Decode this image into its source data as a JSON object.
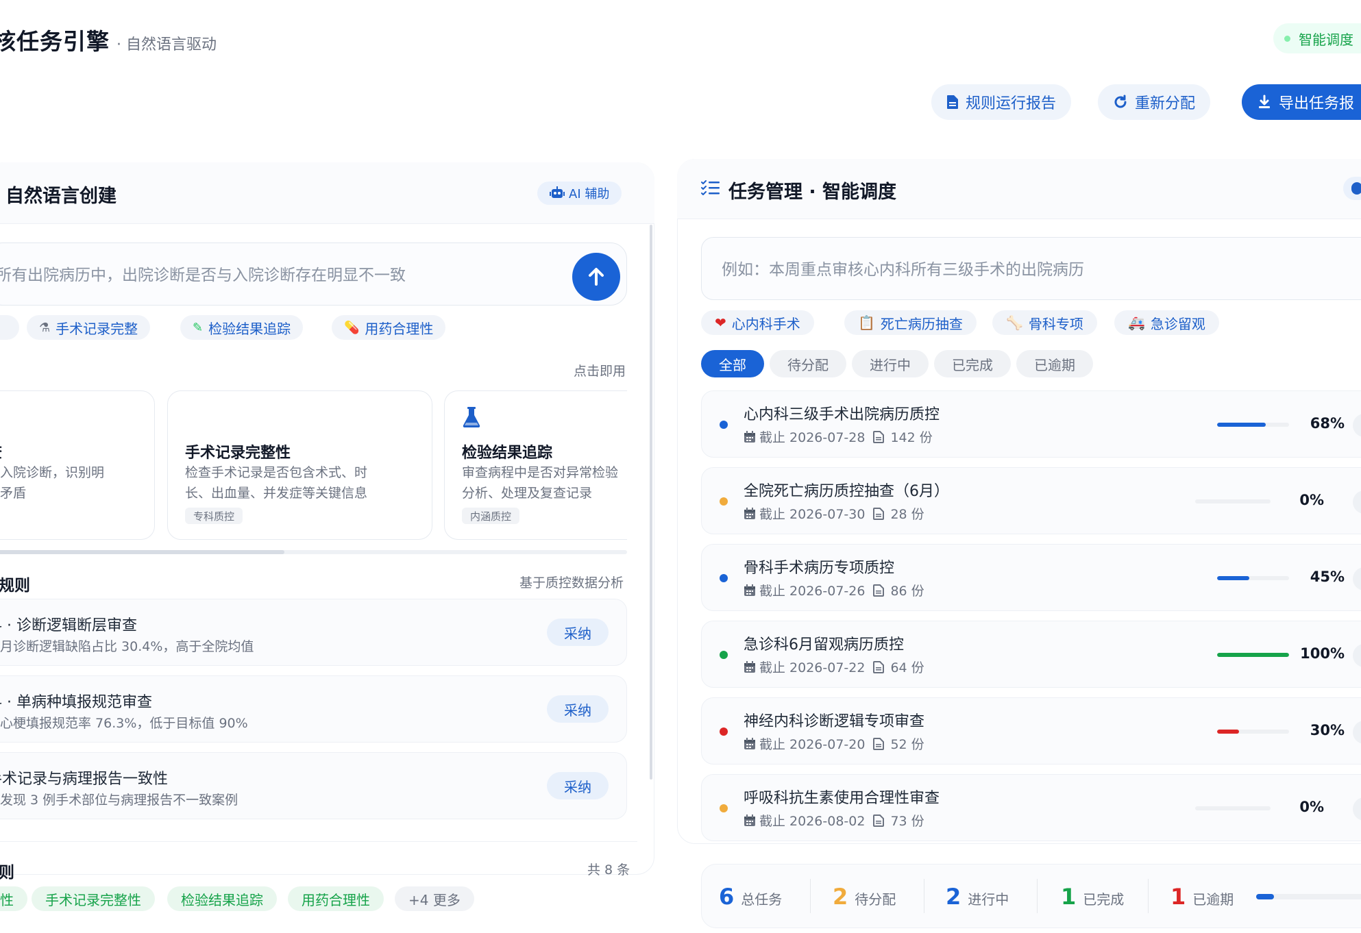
{
  "header": {
    "title": "核任务引擎",
    "subtitle": "· 自然语言驱动",
    "status_badge": "智能调度",
    "buttons": {
      "report": "规则运行报告",
      "reassign": "重新分配",
      "export": "导出任务报"
    }
  },
  "left": {
    "panel_title": "自然语言创建",
    "ai_badge": "AI 辅助",
    "input_value": "所有出院病历中，出院诊断是否与入院诊断存在明显不一致",
    "quick_chips": [
      "手术记录完整",
      "检验结果追踪",
      "用药合理性"
    ],
    "template_hint": "点击即用",
    "templates": [
      {
        "title": "查",
        "desc1": "与入院诊断，识别明",
        "desc2": "盾矛盾"
      },
      {
        "title": "手术记录完整性",
        "desc1": "检查手术记录是否包含术式、时",
        "desc2": "长、出血量、并发症等关键信息",
        "tag": "专科质控"
      },
      {
        "title": "检验结果追踪",
        "desc1": "审查病程中是否对异常检验",
        "desc2": "分析、处理及复查记录",
        "tag": "内涵质控"
      }
    ],
    "rules_title": "规则",
    "rules_hint": "基于质控数据分析",
    "adopt_label": "采纳",
    "rules": [
      {
        "title": "科 · 诊断逻辑断层审查",
        "desc": "三月诊断逻辑缺陷占比 30.4%，高于全院均值"
      },
      {
        "title": "科 · 单病种填报规范审查",
        "desc": "性心梗填报规范率 76.3%，低于目标值 90%"
      },
      {
        "title": "手术记录与病理报告一致性",
        "desc": "期发现 3 例手术部位与病理报告不一致案例"
      }
    ],
    "tags_title": "则",
    "tags_count": "共 8 条",
    "tags": [
      "性",
      "手术记录完整性",
      "检验结果追踪",
      "用药合理性"
    ],
    "more_tag": "+4 更多"
  },
  "right": {
    "panel_title": "任务管理 · 智能调度",
    "input_placeholder": "例如：本周重点审核心内科所有三级手术的出院病历",
    "filter_chips": [
      "心内科手术",
      "死亡病历抽查",
      "骨科专项",
      "急诊留观"
    ],
    "status_tabs": [
      "全部",
      "待分配",
      "进行中",
      "已完成",
      "已逾期"
    ],
    "active_tab": "全部",
    "tasks": [
      {
        "name": "心内科三级手术出院病历质控",
        "deadline": "截止 2026-07-28",
        "count": "142 份",
        "progress": 68,
        "progress_label": "68%",
        "status_color": "#1a63d6"
      },
      {
        "name": "全院死亡病历质控抽查（6月）",
        "deadline": "截止 2026-07-30",
        "count": "28 份",
        "progress": 0,
        "progress_label": "0%",
        "status_color": "#f0ab3c"
      },
      {
        "name": "骨科手术病历专项质控",
        "deadline": "截止 2026-07-26",
        "count": "86 份",
        "progress": 45,
        "progress_label": "45%",
        "status_color": "#1a63d6"
      },
      {
        "name": "急诊科6月留观病历质控",
        "deadline": "截止 2026-07-22",
        "count": "64 份",
        "progress": 100,
        "progress_label": "100%",
        "status_color": "#16a34a"
      },
      {
        "name": "神经内科诊断逻辑专项审查",
        "deadline": "截止 2026-07-20",
        "count": "52 份",
        "progress": 30,
        "progress_label": "30%",
        "status_color": "#dc2626"
      },
      {
        "name": "呼吸科抗生素使用合理性审查",
        "deadline": "截止 2026-08-02",
        "count": "73 份",
        "progress": 0,
        "progress_label": "0%",
        "status_color": "#f0ab3c"
      }
    ],
    "summary": [
      {
        "n": "6",
        "label": "总任务",
        "color": "#1a63d6"
      },
      {
        "n": "2",
        "label": "待分配",
        "color": "#f0ab3c"
      },
      {
        "n": "2",
        "label": "进行中",
        "color": "#1a63d6"
      },
      {
        "n": "1",
        "label": "已完成",
        "color": "#16a34a"
      },
      {
        "n": "1",
        "label": "已逾期",
        "color": "#dc2626"
      }
    ],
    "summary_progress": 0.13
  },
  "colors": {
    "primary": "#1a63d6",
    "success": "#16a34a",
    "warning": "#f0ab3c",
    "danger": "#dc2626"
  }
}
